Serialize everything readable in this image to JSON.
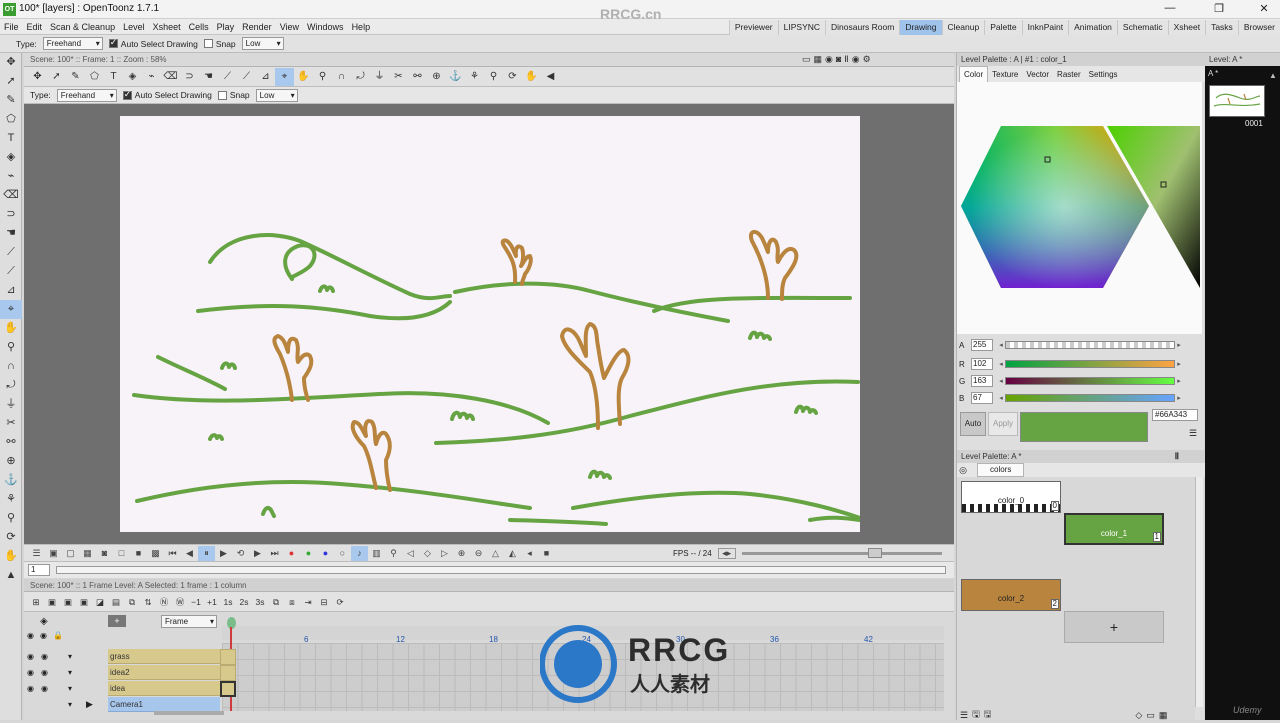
{
  "window": {
    "title": "100* [layers] : OpenToonz 1.7.1",
    "logo": "OT"
  },
  "menus": [
    "File",
    "Edit",
    "Scan & Cleanup",
    "Level",
    "Xsheet",
    "Cells",
    "Play",
    "Render",
    "View",
    "Windows",
    "Help"
  ],
  "rooms": [
    "Previewer",
    "LIPSYNC",
    "Dinosaurs Room",
    "Drawing",
    "Cleanup",
    "Palette",
    "InknPaint",
    "Animation",
    "Schematic",
    "Xsheet",
    "Tasks",
    "Browser"
  ],
  "active_room": "Drawing",
  "tool_options": {
    "type_label": "Type:",
    "type_value": "Freehand",
    "auto_select": "Auto Select Drawing",
    "snap": "Snap",
    "snap_value": "Low"
  },
  "viewer": {
    "header": "Scene: 100*  ::  Frame: 1  ::  Zoom : 58%",
    "fps_label": "FPS -- / 24",
    "frame_field": "1"
  },
  "xsheet": {
    "header": "Scene: 100*  ::  1 Frame  Level: A  Selected: 1 frame : 1 column",
    "frame_mode": "Frame",
    "frame_numbers": [
      "6",
      "12",
      "18",
      "24",
      "30",
      "36",
      "42"
    ],
    "layers": [
      {
        "name": "grass"
      },
      {
        "name": "idea2"
      },
      {
        "name": "idea"
      },
      {
        "name": "Camera1"
      }
    ]
  },
  "style_editor": {
    "header": "Level Palette : A | #1 : color_1",
    "tabs": [
      "Color",
      "Texture",
      "Vector",
      "Raster",
      "Settings"
    ],
    "channels": [
      {
        "label": "A",
        "value": "255"
      },
      {
        "label": "R",
        "value": "102"
      },
      {
        "label": "G",
        "value": "163"
      },
      {
        "label": "B",
        "value": "67"
      }
    ],
    "auto_label": "Auto",
    "apply_label": "Apply",
    "hex": "#66A343",
    "current_color": "#66A343"
  },
  "level_palette": {
    "header": "Level Palette: A *",
    "tab": "colors",
    "styles": [
      {
        "name": "color_0",
        "index": "0"
      },
      {
        "name": "color_1",
        "index": "1",
        "color": "#66A343"
      },
      {
        "name": "color_2",
        "index": "2",
        "color": "#B8843E"
      }
    ],
    "add_label": "+"
  },
  "level_strip": {
    "header": "Level: A *",
    "sub": "A *",
    "frame": "0001"
  },
  "watermark": {
    "line1": "RRCG",
    "line2": "人人素材",
    "top": "RRCG.cn",
    "corner": "Udemy"
  },
  "colors": {
    "grass": "#66A343",
    "trunk": "#B8843E",
    "active_room": "#9fc3ea"
  }
}
